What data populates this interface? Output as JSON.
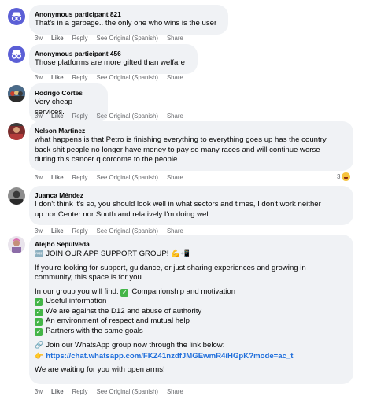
{
  "actions": {
    "time": "3w",
    "like": "Like",
    "reply": "Reply",
    "see_original": "See Original (Spanish)",
    "share": "Share"
  },
  "comments": [
    {
      "author": "Anonymous participant 821",
      "avatar": "anonymous-avatar",
      "lines": [
        "That's in a garbage.. the only one who wins is the user"
      ]
    },
    {
      "author": "Anonymous participant 456",
      "avatar": "anonymous-avatar",
      "lines": [
        "Those platforms are more gifted than welfare"
      ]
    },
    {
      "author": "Rodrigo Cortes",
      "avatar": "profile-photo",
      "lines": [
        "Very cheap services."
      ]
    },
    {
      "author": "Nelson Martinez",
      "avatar": "profile-photo",
      "lines": [
        "what happens is that Petro is finishing everything to everything goes up has the country",
        "back shit people no longer have money to pay so many races and will continue worse",
        "during this cancer q corcome to the people"
      ],
      "reaction_count": "3"
    },
    {
      "author": "Juanca Méndez",
      "avatar": "profile-photo",
      "lines": [
        "I don't think it's so, you should look well in what sectors and times, I don't work neither",
        "up nor Center nor South and relatively I'm doing well"
      ]
    },
    {
      "author": "Alejho Sepúlveda",
      "avatar": "profile-photo",
      "post": {
        "heading": "JOIN OUR APP SUPPORT GROUP!",
        "intro_1": "If you're looking for support, guidance, or just sharing experiences and growing in",
        "intro_2": "community, this space is for you.",
        "find_label": "In our group you will find:",
        "items": [
          "Companionship and motivation",
          "Useful information",
          "We are against the D12 and abuse of authority",
          "An environment of respect and mutual help",
          "Partners with the same goals"
        ],
        "whatsapp_text": "Join our WhatsApp group now through the link below:",
        "link": "https://chat.whatsapp.com/FKZ41nzdfJMGEwmR4iHGpK?mode=ac_t",
        "closing": "We are waiting for you with open arms!"
      }
    }
  ],
  "colors": {
    "bubble": "#f0f2f5",
    "meta_text": "#65676b",
    "link": "#216fdb",
    "anon_avatar": "#5b5fd6",
    "check": "#44b548"
  }
}
